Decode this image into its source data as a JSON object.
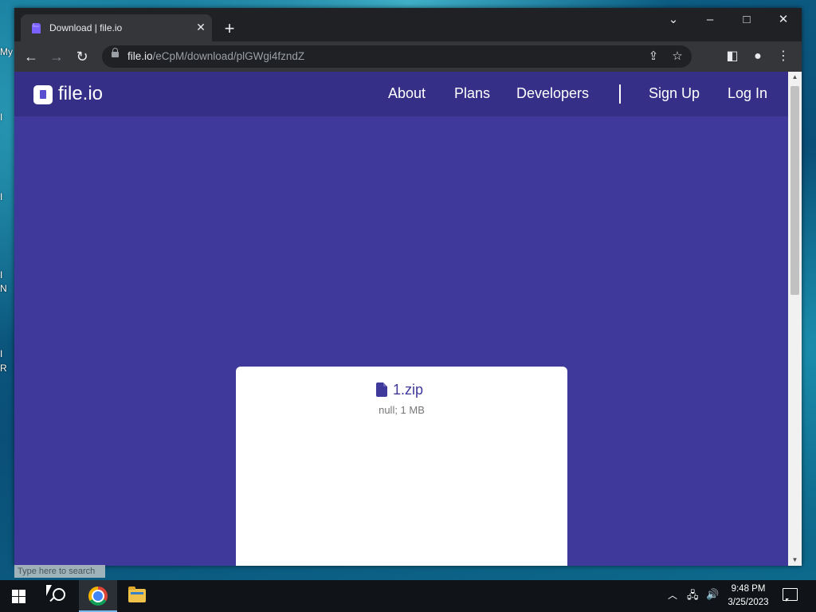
{
  "desktop": {
    "labels": [
      "My",
      "I",
      "I",
      "I",
      "N",
      "I",
      "R"
    ]
  },
  "browser": {
    "tab": {
      "title": "Download | file.io",
      "favicon": "fileio-favicon"
    },
    "new_tab_icon": "+",
    "window_controls": {
      "tab_search": "⌄",
      "minimize": "–",
      "maximize": "□",
      "close": "✕"
    },
    "address_bar": {
      "host": "file.io",
      "path": "/eCpM/download/plGWgi4fzndZ"
    },
    "icons": [
      "back-icon",
      "forward-icon",
      "reload-icon",
      "lock-icon",
      "share-icon",
      "star-icon",
      "side-panel-icon",
      "profile-icon",
      "menu-icon"
    ]
  },
  "site": {
    "logo_text": "file.io",
    "nav": {
      "about": "About",
      "plans": "Plans",
      "developers": "Developers",
      "signup": "Sign Up",
      "login": "Log In"
    },
    "file": {
      "name": "1.zip",
      "meta": "null; 1 MB"
    },
    "colors": {
      "page_bg": "#3f399c",
      "header_bg": "#352f87",
      "card_bg": "#ffffff"
    }
  },
  "status_tip": "Type here to search",
  "taskbar": {
    "clock_time": "9:48 PM",
    "clock_date": "3/25/2023",
    "apps": [
      "start-icon",
      "search-icon",
      "chrome-icon",
      "file-explorer-icon"
    ]
  }
}
